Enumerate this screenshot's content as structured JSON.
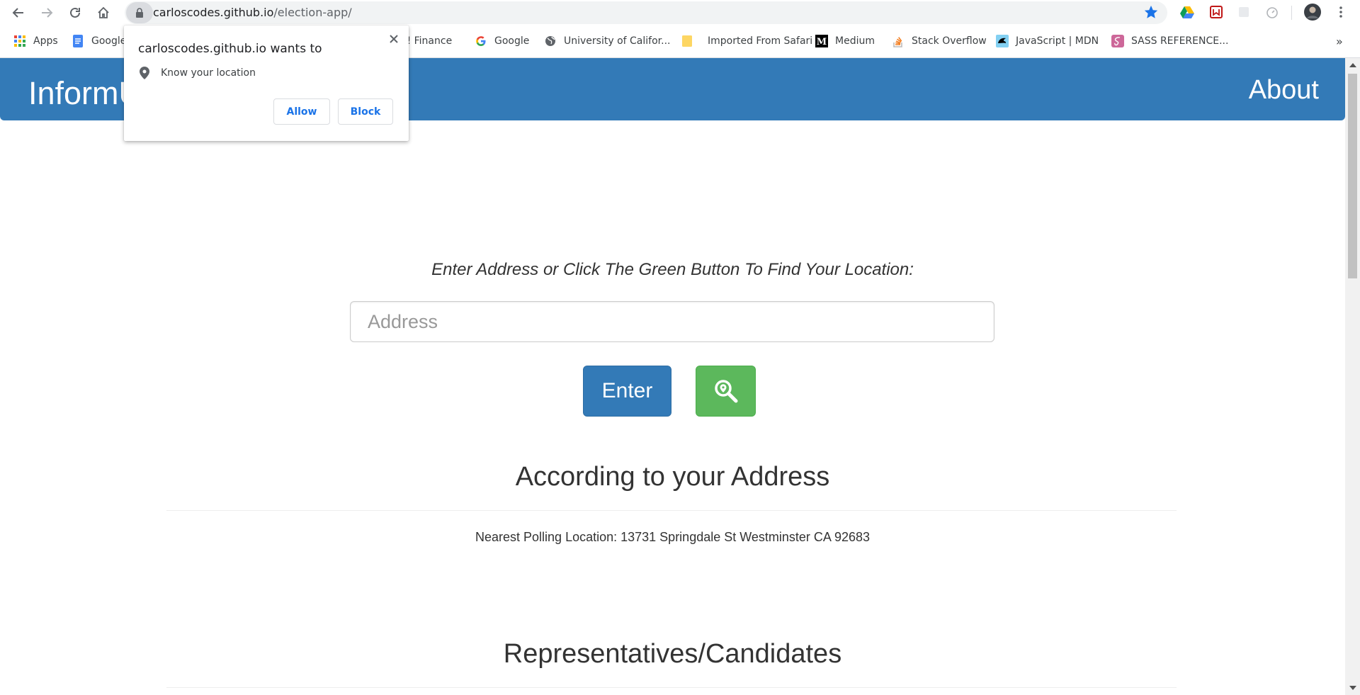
{
  "browser": {
    "url_host": "carloscodes.github.io",
    "url_path": "/election-app/",
    "bookmarks": [
      {
        "label": "Apps",
        "icon": "apps-grid-icon"
      },
      {
        "label": "Google",
        "icon": "google-docs-icon"
      },
      {
        "label": "o! Finance",
        "icon": "yahoo-finance-icon"
      },
      {
        "label": "Google",
        "icon": "google-g-icon"
      },
      {
        "label": "University of Califor...",
        "icon": "globe-icon"
      },
      {
        "label": "Imported From Safari",
        "icon": "folder-icon"
      },
      {
        "label": "Medium",
        "icon": "medium-icon"
      },
      {
        "label": "Stack Overflow",
        "icon": "stack-overflow-icon"
      },
      {
        "label": "JavaScript | MDN",
        "icon": "mdn-icon"
      },
      {
        "label": "SASS REFERENCE...",
        "icon": "sass-icon"
      }
    ],
    "overflow": "»"
  },
  "popup": {
    "title": "carloscodes.github.io wants to",
    "permission": "Know your location",
    "allow": "Allow",
    "block": "Block"
  },
  "navbar": {
    "brand": "InformU",
    "about": "About"
  },
  "main": {
    "prompt": "Enter Address or Click The Green Button To Find Your Location:",
    "address_placeholder": "Address",
    "enter_button": "Enter",
    "address_heading": "According to your Address",
    "polling_location": "Nearest Polling Location: 13731 Springdale St Westminster CA 92683",
    "representatives_heading": "Representatives/Candidates"
  },
  "colors": {
    "navbar": "#337ab7",
    "enter_button": "#337ab7",
    "locate_button": "#5cb85c",
    "popup_button_text": "#1a73e8"
  }
}
